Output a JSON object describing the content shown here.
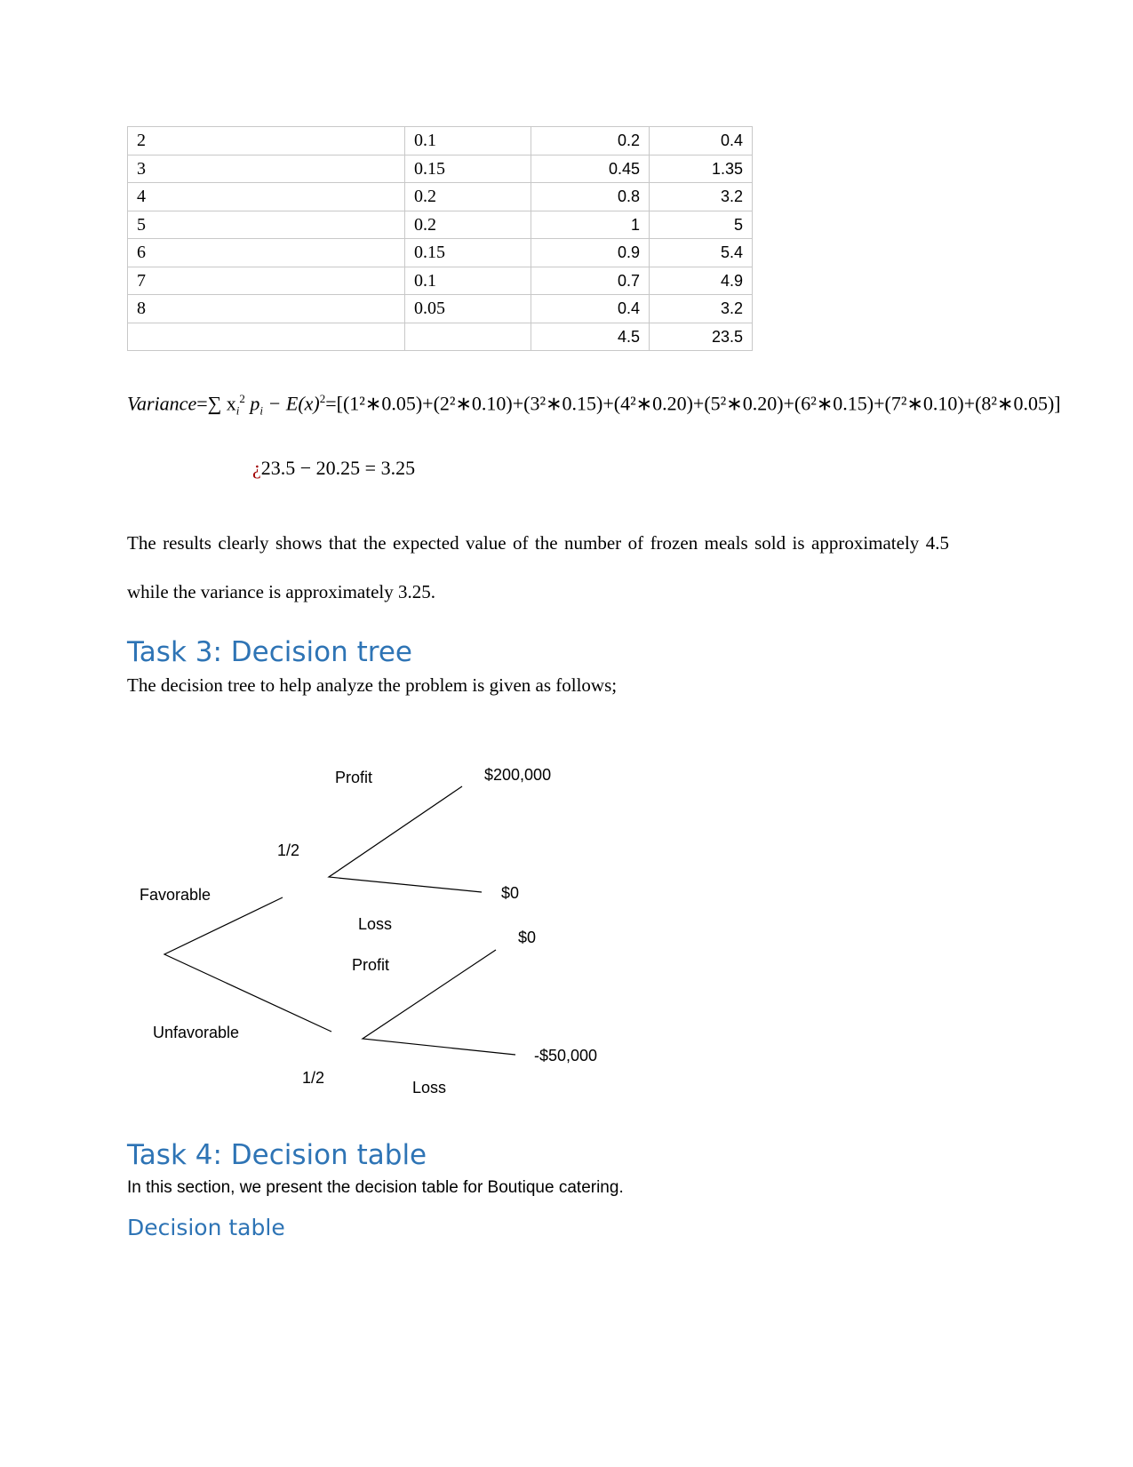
{
  "table": {
    "rows": [
      [
        "2",
        "0.1",
        "0.2",
        "0.4"
      ],
      [
        "3",
        "0.15",
        "0.45",
        "1.35"
      ],
      [
        "4",
        "0.2",
        "0.8",
        "3.2"
      ],
      [
        "5",
        "0.2",
        "1",
        "5"
      ],
      [
        "6",
        "0.15",
        "0.9",
        "5.4"
      ],
      [
        "7",
        "0.1",
        "0.7",
        "4.9"
      ],
      [
        "8",
        "0.05",
        "0.4",
        "3.2"
      ],
      [
        "",
        "",
        "4.5",
        "23.5"
      ]
    ]
  },
  "formula": {
    "line1_lhs": "Variance",
    "line1_rest": "=∑ x",
    "line1_tail": " p",
    "line1_tail2": " − E(x)",
    "line1_terms": "=[(1²∗0.05)+(2²∗0.10)+(3²∗0.15)+(4²∗0.20)+(5²∗0.20)+(6²∗0.15)+(7²∗0.10)+(8²∗0.05)]",
    "line2_mark": "¿",
    "line2": "23.5 − 20.25 = 3.25"
  },
  "paragraph1": "The results clearly shows that the expected value of the number of frozen meals sold is approximately 4.5 while the variance is approximately 3.25.",
  "task3": {
    "heading": "Task 3: Decision tree",
    "intro": "The decision tree to help analyze the problem is given as follows;"
  },
  "tree": {
    "profit1": "Profit",
    "payoff1": "$200,000",
    "prob1": "1/2",
    "favorable": "Favorable",
    "payoff2": "$0",
    "loss1": "Loss",
    "payoff3": "$0",
    "profit2": "Profit",
    "unfavorable": "Unfavorable",
    "payoff4": "-$50,000",
    "prob2": "1/2",
    "loss2": "Loss"
  },
  "task4": {
    "heading": "Task 4: Decision table",
    "intro": "In this section, we present the decision table for Boutique catering.",
    "subheading": "Decision table"
  },
  "colors": {
    "heading": "#2e74b5",
    "mark": "#a00000"
  }
}
